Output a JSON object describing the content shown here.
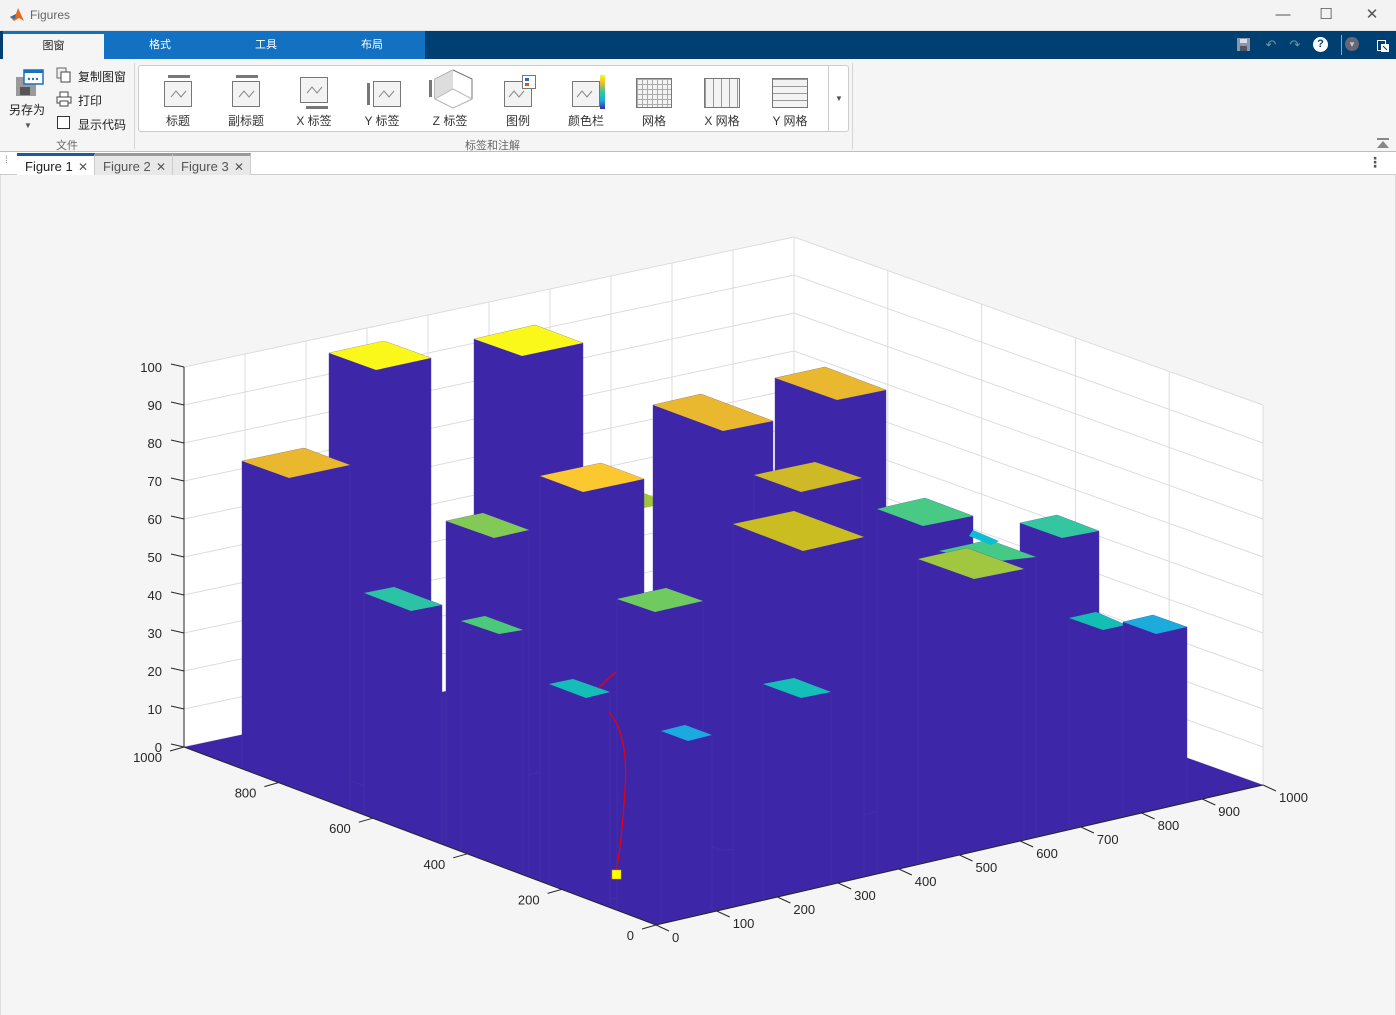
{
  "window": {
    "title": "Figures",
    "minimize": "—",
    "maximize": "☐",
    "close": "✕"
  },
  "ribbon_tabs": [
    "图窗",
    "格式",
    "工具",
    "布局"
  ],
  "quick_access": {
    "save": "save-icon",
    "undo": "undo-icon",
    "redo": "redo-icon",
    "help": "?",
    "menu": "▾"
  },
  "file_group": {
    "save_as": "另存为",
    "copy_figure": "复制图窗",
    "print": "打印",
    "show_code": "显示代码",
    "show_code_checked": false,
    "label": "文件"
  },
  "annot_group": {
    "label": "标签和注解",
    "items": [
      "标题",
      "副标题",
      "X 标签",
      "Y 标签",
      "Z 标签",
      "图例",
      "颜色栏",
      "网格",
      "X 网格",
      "Y 网格"
    ]
  },
  "figure_tabs": [
    {
      "label": "Figure 1",
      "active": true
    },
    {
      "label": "Figure 2",
      "active": false
    },
    {
      "label": "Figure 3",
      "active": false
    }
  ],
  "plot": {
    "z_ticks": [
      "0",
      "10",
      "20",
      "30",
      "40",
      "50",
      "60",
      "70",
      "80",
      "90",
      "100"
    ],
    "y_ticks": [
      "0",
      "200",
      "400",
      "600",
      "800",
      "1000"
    ],
    "x_ticks": [
      "0",
      "100",
      "200",
      "300",
      "400",
      "500",
      "600",
      "700",
      "800",
      "900",
      "1000"
    ],
    "colors": {
      "bar_side": "#3d27a8",
      "floor": "#3d27a8",
      "wall": "#ffffff",
      "grid": "#dcdcdc",
      "path_line": "#e8000b",
      "marker": "#ffff00"
    },
    "bars": [
      {
        "z": 100,
        "color": "#f9f81a"
      },
      {
        "z": 100,
        "color": "#f9f81a"
      },
      {
        "z": 88,
        "color": "#e9b82f"
      },
      {
        "z": 80,
        "color": "#e9b82f"
      },
      {
        "z": 75,
        "color": "#e9b82f"
      },
      {
        "z": 68,
        "color": "#fcc830"
      },
      {
        "z": 60,
        "color": "#cdba26"
      },
      {
        "z": 58,
        "color": "#83c955"
      },
      {
        "z": 52,
        "color": "#48ca85"
      },
      {
        "z": 48,
        "color": "#33c6a0"
      },
      {
        "z": 46,
        "color": "#44ca86"
      },
      {
        "z": 57,
        "color": "#c9bd22"
      },
      {
        "z": 45,
        "color": "#a1c63f"
      },
      {
        "z": 38,
        "color": "#2cc2a6"
      },
      {
        "z": 30,
        "color": "#4cc87a"
      },
      {
        "z": 40,
        "color": "#6fcb60"
      },
      {
        "z": 23,
        "color": "#13beb4"
      },
      {
        "z": 22,
        "color": "#1dabdc"
      },
      {
        "z": 18,
        "color": "#15bdb7"
      },
      {
        "z": 14,
        "color": "#14bfb7"
      },
      {
        "z": 6,
        "color": "#1ca9df"
      }
    ]
  }
}
